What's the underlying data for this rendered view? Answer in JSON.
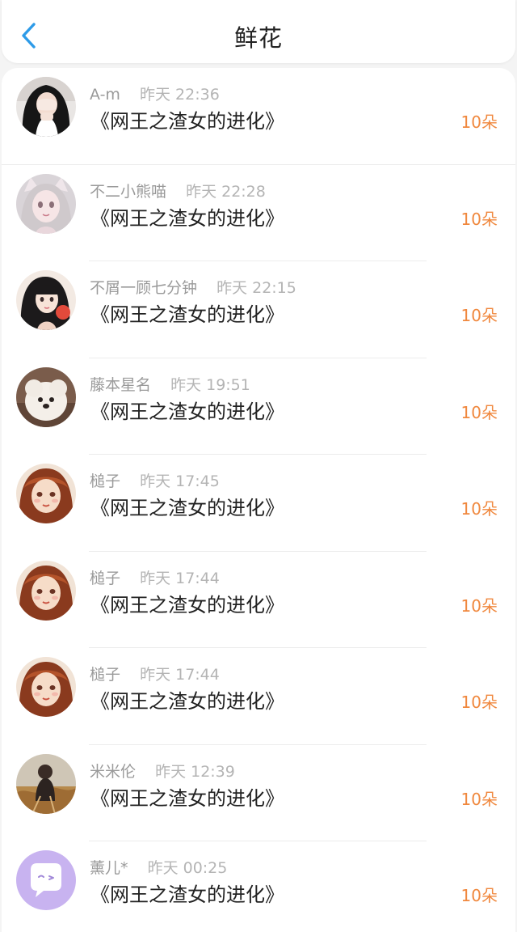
{
  "header": {
    "title": "鲜花",
    "back_icon": "chevron-left-icon",
    "accent_color": "#2d9be8"
  },
  "colors": {
    "amount": "#f0883e",
    "name": "#9a9a9a",
    "title": "#222222"
  },
  "rows": [
    {
      "name": "A-m",
      "time": "昨天 22:36",
      "book": "《网王之渣女的进化》",
      "amount": "10朵",
      "avatar": "avatar-photo-girl-covering-face"
    },
    {
      "name": "不二小熊喵",
      "time": "昨天 22:28",
      "book": "《网王之渣女的进化》",
      "amount": "10朵",
      "avatar": "avatar-illustration-cat-ear-girl"
    },
    {
      "name": "不屑一顾七分钟",
      "time": "昨天 22:15",
      "book": "《网王之渣女的进化》",
      "amount": "10朵",
      "avatar": "avatar-illustration-dark-hair-girl"
    },
    {
      "name": "藤本星名",
      "time": "昨天 19:51",
      "book": "《网王之渣女的进化》",
      "amount": "10朵",
      "avatar": "avatar-photo-white-puppy"
    },
    {
      "name": "槌子",
      "time": "昨天 17:45",
      "book": "《网王之渣女的进化》",
      "amount": "10朵",
      "avatar": "avatar-illustration-red-hair-girl"
    },
    {
      "name": "槌子",
      "time": "昨天 17:44",
      "book": "《网王之渣女的进化》",
      "amount": "10朵",
      "avatar": "avatar-illustration-red-hair-girl"
    },
    {
      "name": "槌子",
      "time": "昨天 17:44",
      "book": "《网王之渣女的进化》",
      "amount": "10朵",
      "avatar": "avatar-illustration-red-hair-girl"
    },
    {
      "name": "米米伦",
      "time": "昨天 12:39",
      "book": "《网王之渣女的进化》",
      "amount": "10朵",
      "avatar": "avatar-photo-person-in-field"
    },
    {
      "name": "薰儿*",
      "time": "昨天 00:25",
      "book": "《网王之渣女的进化》",
      "amount": "10朵",
      "avatar": "avatar-default-chat-bubble"
    }
  ]
}
